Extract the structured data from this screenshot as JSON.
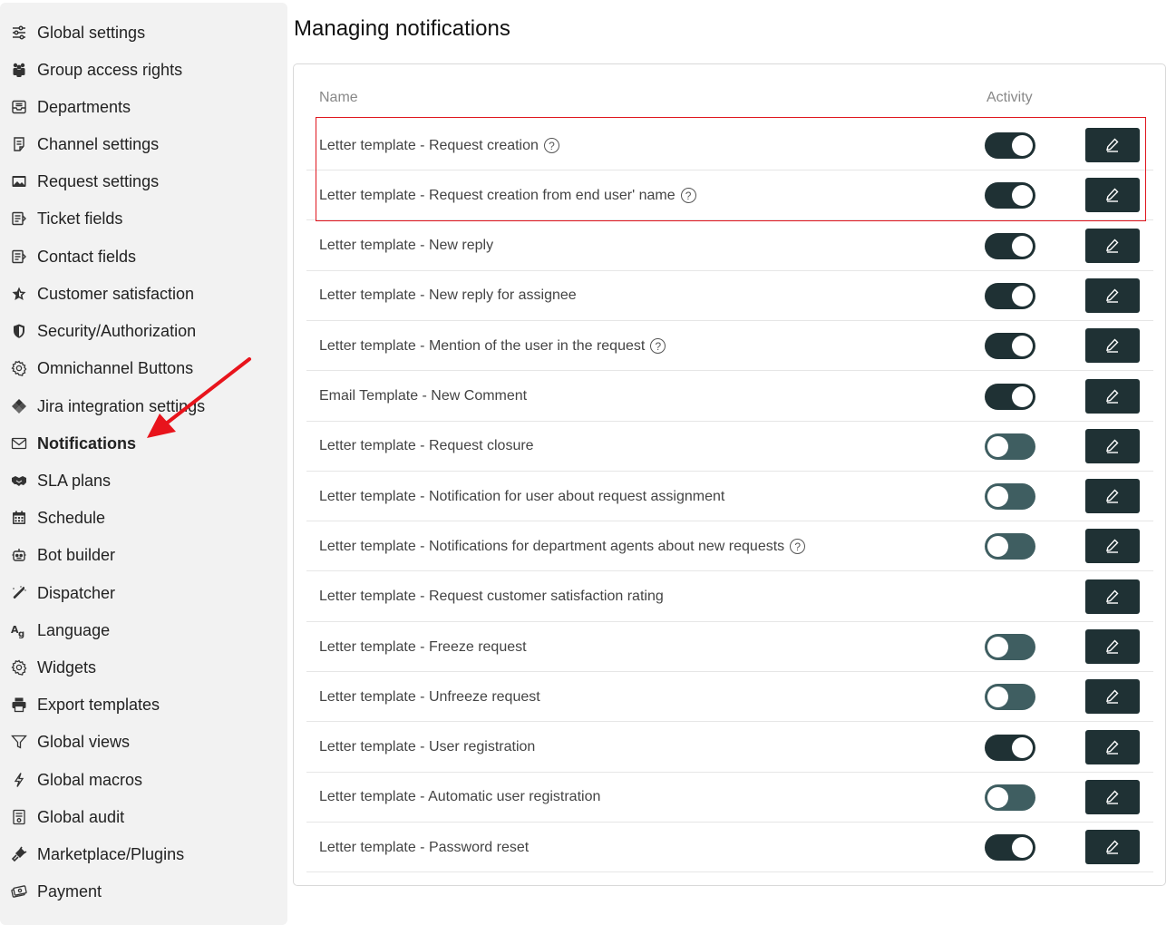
{
  "sidebar": {
    "items": [
      {
        "label": "Global settings",
        "icon": "sliders-icon",
        "active": false
      },
      {
        "label": "Group access rights",
        "icon": "users-group-icon",
        "active": false
      },
      {
        "label": "Departments",
        "icon": "inbox-icon",
        "active": false
      },
      {
        "label": "Channel settings",
        "icon": "list-doc-icon",
        "active": false
      },
      {
        "label": "Request settings",
        "icon": "image-box-icon",
        "active": false
      },
      {
        "label": "Ticket fields",
        "icon": "form-fields-icon",
        "active": false
      },
      {
        "label": "Contact fields",
        "icon": "form-fields-icon",
        "active": false
      },
      {
        "label": "Customer satisfaction",
        "icon": "star-icon",
        "active": false
      },
      {
        "label": "Security/Authorization",
        "icon": "shield-icon",
        "active": false
      },
      {
        "label": "Omnichannel Buttons",
        "icon": "gear-icon",
        "active": false
      },
      {
        "label": "Jira integration settings",
        "icon": "jira-icon",
        "active": false
      },
      {
        "label": "Notifications",
        "icon": "envelope-icon",
        "active": true
      },
      {
        "label": "SLA plans",
        "icon": "handshake-icon",
        "active": false
      },
      {
        "label": "Schedule",
        "icon": "calendar-icon",
        "active": false
      },
      {
        "label": "Bot builder",
        "icon": "robot-icon",
        "active": false
      },
      {
        "label": "Dispatcher",
        "icon": "magic-wand-icon",
        "active": false
      },
      {
        "label": "Language",
        "icon": "language-icon",
        "active": false
      },
      {
        "label": "Widgets",
        "icon": "gear-icon",
        "active": false
      },
      {
        "label": "Export templates",
        "icon": "printer-icon",
        "active": false
      },
      {
        "label": "Global views",
        "icon": "filter-icon",
        "active": false
      },
      {
        "label": "Global macros",
        "icon": "bolt-icon",
        "active": false
      },
      {
        "label": "Global audit",
        "icon": "audit-doc-icon",
        "active": false
      },
      {
        "label": "Marketplace/Plugins",
        "icon": "plug-icon",
        "active": false
      },
      {
        "label": "Payment",
        "icon": "money-icon",
        "active": false
      }
    ]
  },
  "page": {
    "title": "Managing notifications",
    "col_name": "Name",
    "col_activity": "Activity"
  },
  "rows": [
    {
      "name": "Letter template - Request creation",
      "help": true,
      "toggle": "on"
    },
    {
      "name": "Letter template - Request creation from end user' name",
      "help": true,
      "toggle": "on"
    },
    {
      "name": "Letter template - New reply",
      "help": false,
      "toggle": "on"
    },
    {
      "name": "Letter template - New reply for assignee",
      "help": false,
      "toggle": "on"
    },
    {
      "name": "Letter template - Mention of the user in the request",
      "help": true,
      "toggle": "on"
    },
    {
      "name": "Email Template - New Comment",
      "help": false,
      "toggle": "on"
    },
    {
      "name": "Letter template - Request closure",
      "help": false,
      "toggle": "off"
    },
    {
      "name": "Letter template - Notification for user about request assignment",
      "help": false,
      "toggle": "off"
    },
    {
      "name": "Letter template - Notifications for department agents about new requests",
      "help": true,
      "toggle": "off"
    },
    {
      "name": "Letter template - Request customer satisfaction rating",
      "help": false,
      "toggle": "none"
    },
    {
      "name": "Letter template - Freeze request",
      "help": false,
      "toggle": "off"
    },
    {
      "name": "Letter template - Unfreeze request",
      "help": false,
      "toggle": "off"
    },
    {
      "name": "Letter template - User registration",
      "help": false,
      "toggle": "on"
    },
    {
      "name": "Letter template - Automatic user registration",
      "help": false,
      "toggle": "off"
    },
    {
      "name": "Letter template - Password reset",
      "help": false,
      "toggle": "on"
    }
  ],
  "colors": {
    "toggle_on": "#1f3134",
    "toggle_off": "#3f5e61",
    "edit_button": "#1f3134",
    "highlight": "#e0161e",
    "arrow": "#e8141c"
  }
}
